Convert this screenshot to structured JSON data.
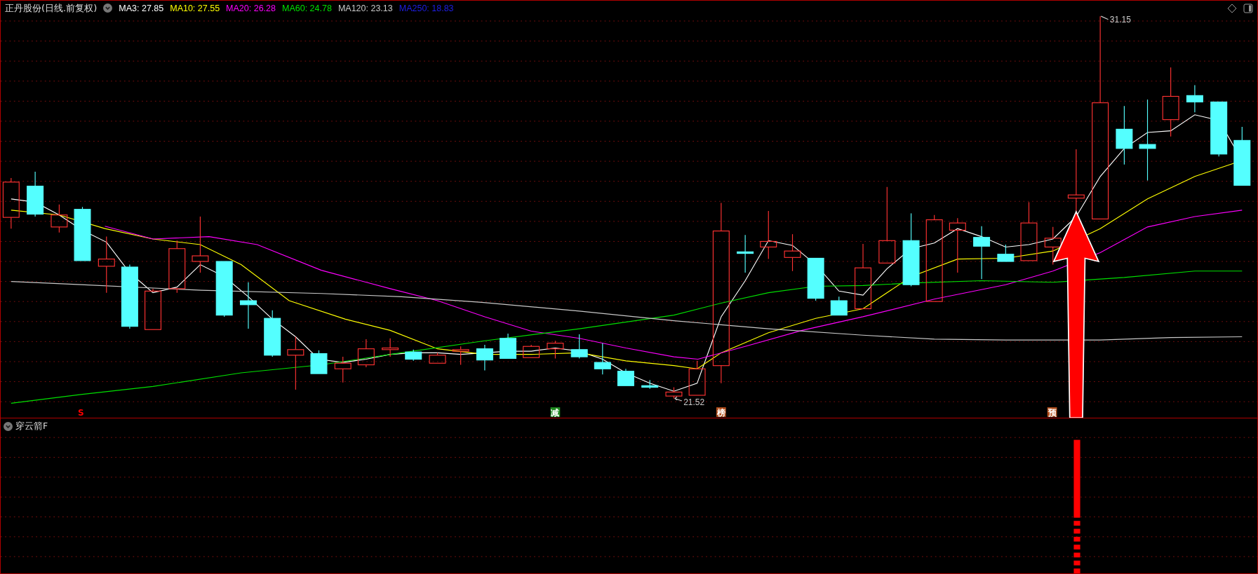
{
  "header": {
    "title": "正丹股份(日线.前复权)",
    "indicators": [
      {
        "label": "MA3: 27.85",
        "color": "#ffffff"
      },
      {
        "label": "MA10: 27.55",
        "color": "#ffff00"
      },
      {
        "label": "MA20: 26.28",
        "color": "#ff00ff"
      },
      {
        "label": "MA60: 24.78",
        "color": "#00e000"
      },
      {
        "label": "MA120: 23.13",
        "color": "#c8c8c8"
      },
      {
        "label": "MA250: 18.83",
        "color": "#1e1ee6"
      }
    ]
  },
  "chart": {
    "high_label": "31.15",
    "low_label": "21.52",
    "signals": [
      {
        "label": "S",
        "kind": "text",
        "color": "#ff0000"
      },
      {
        "label": "减",
        "kind": "tag",
        "color": "#1f8a1f"
      },
      {
        "label": "榜",
        "kind": "tag",
        "color": "#b4501e"
      },
      {
        "label": "预",
        "kind": "tag",
        "color": "#b4501e"
      }
    ]
  },
  "lower_panel": {
    "title": "穿云箭F"
  }
}
